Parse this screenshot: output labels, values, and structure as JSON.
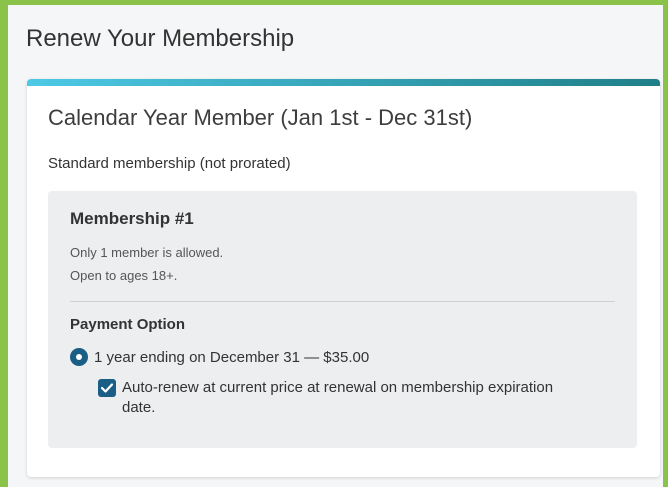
{
  "page": {
    "title": "Renew Your Membership"
  },
  "plan": {
    "title": "Calendar Year Member (Jan 1st - Dec 31st)",
    "subtitle": "Standard membership (not prorated)"
  },
  "membership": {
    "title": "Membership #1",
    "lines": [
      "Only 1 member is allowed.",
      "Open to ages 18+."
    ],
    "payment_label": "Payment Option",
    "option": {
      "label": "1 year ending on December 31 — $35.00",
      "selected": true
    },
    "auto_renew": {
      "label": "Auto-renew at current price at renewal on membership expiration date.",
      "checked": true
    }
  },
  "colors": {
    "frame": "#8bc34a",
    "accent_start": "#4dc9e6",
    "accent_end": "#1f7f88",
    "control": "#1a5e86"
  },
  "icons": {
    "radio": "radio-selected-icon",
    "checkbox": "checkmark-icon"
  }
}
